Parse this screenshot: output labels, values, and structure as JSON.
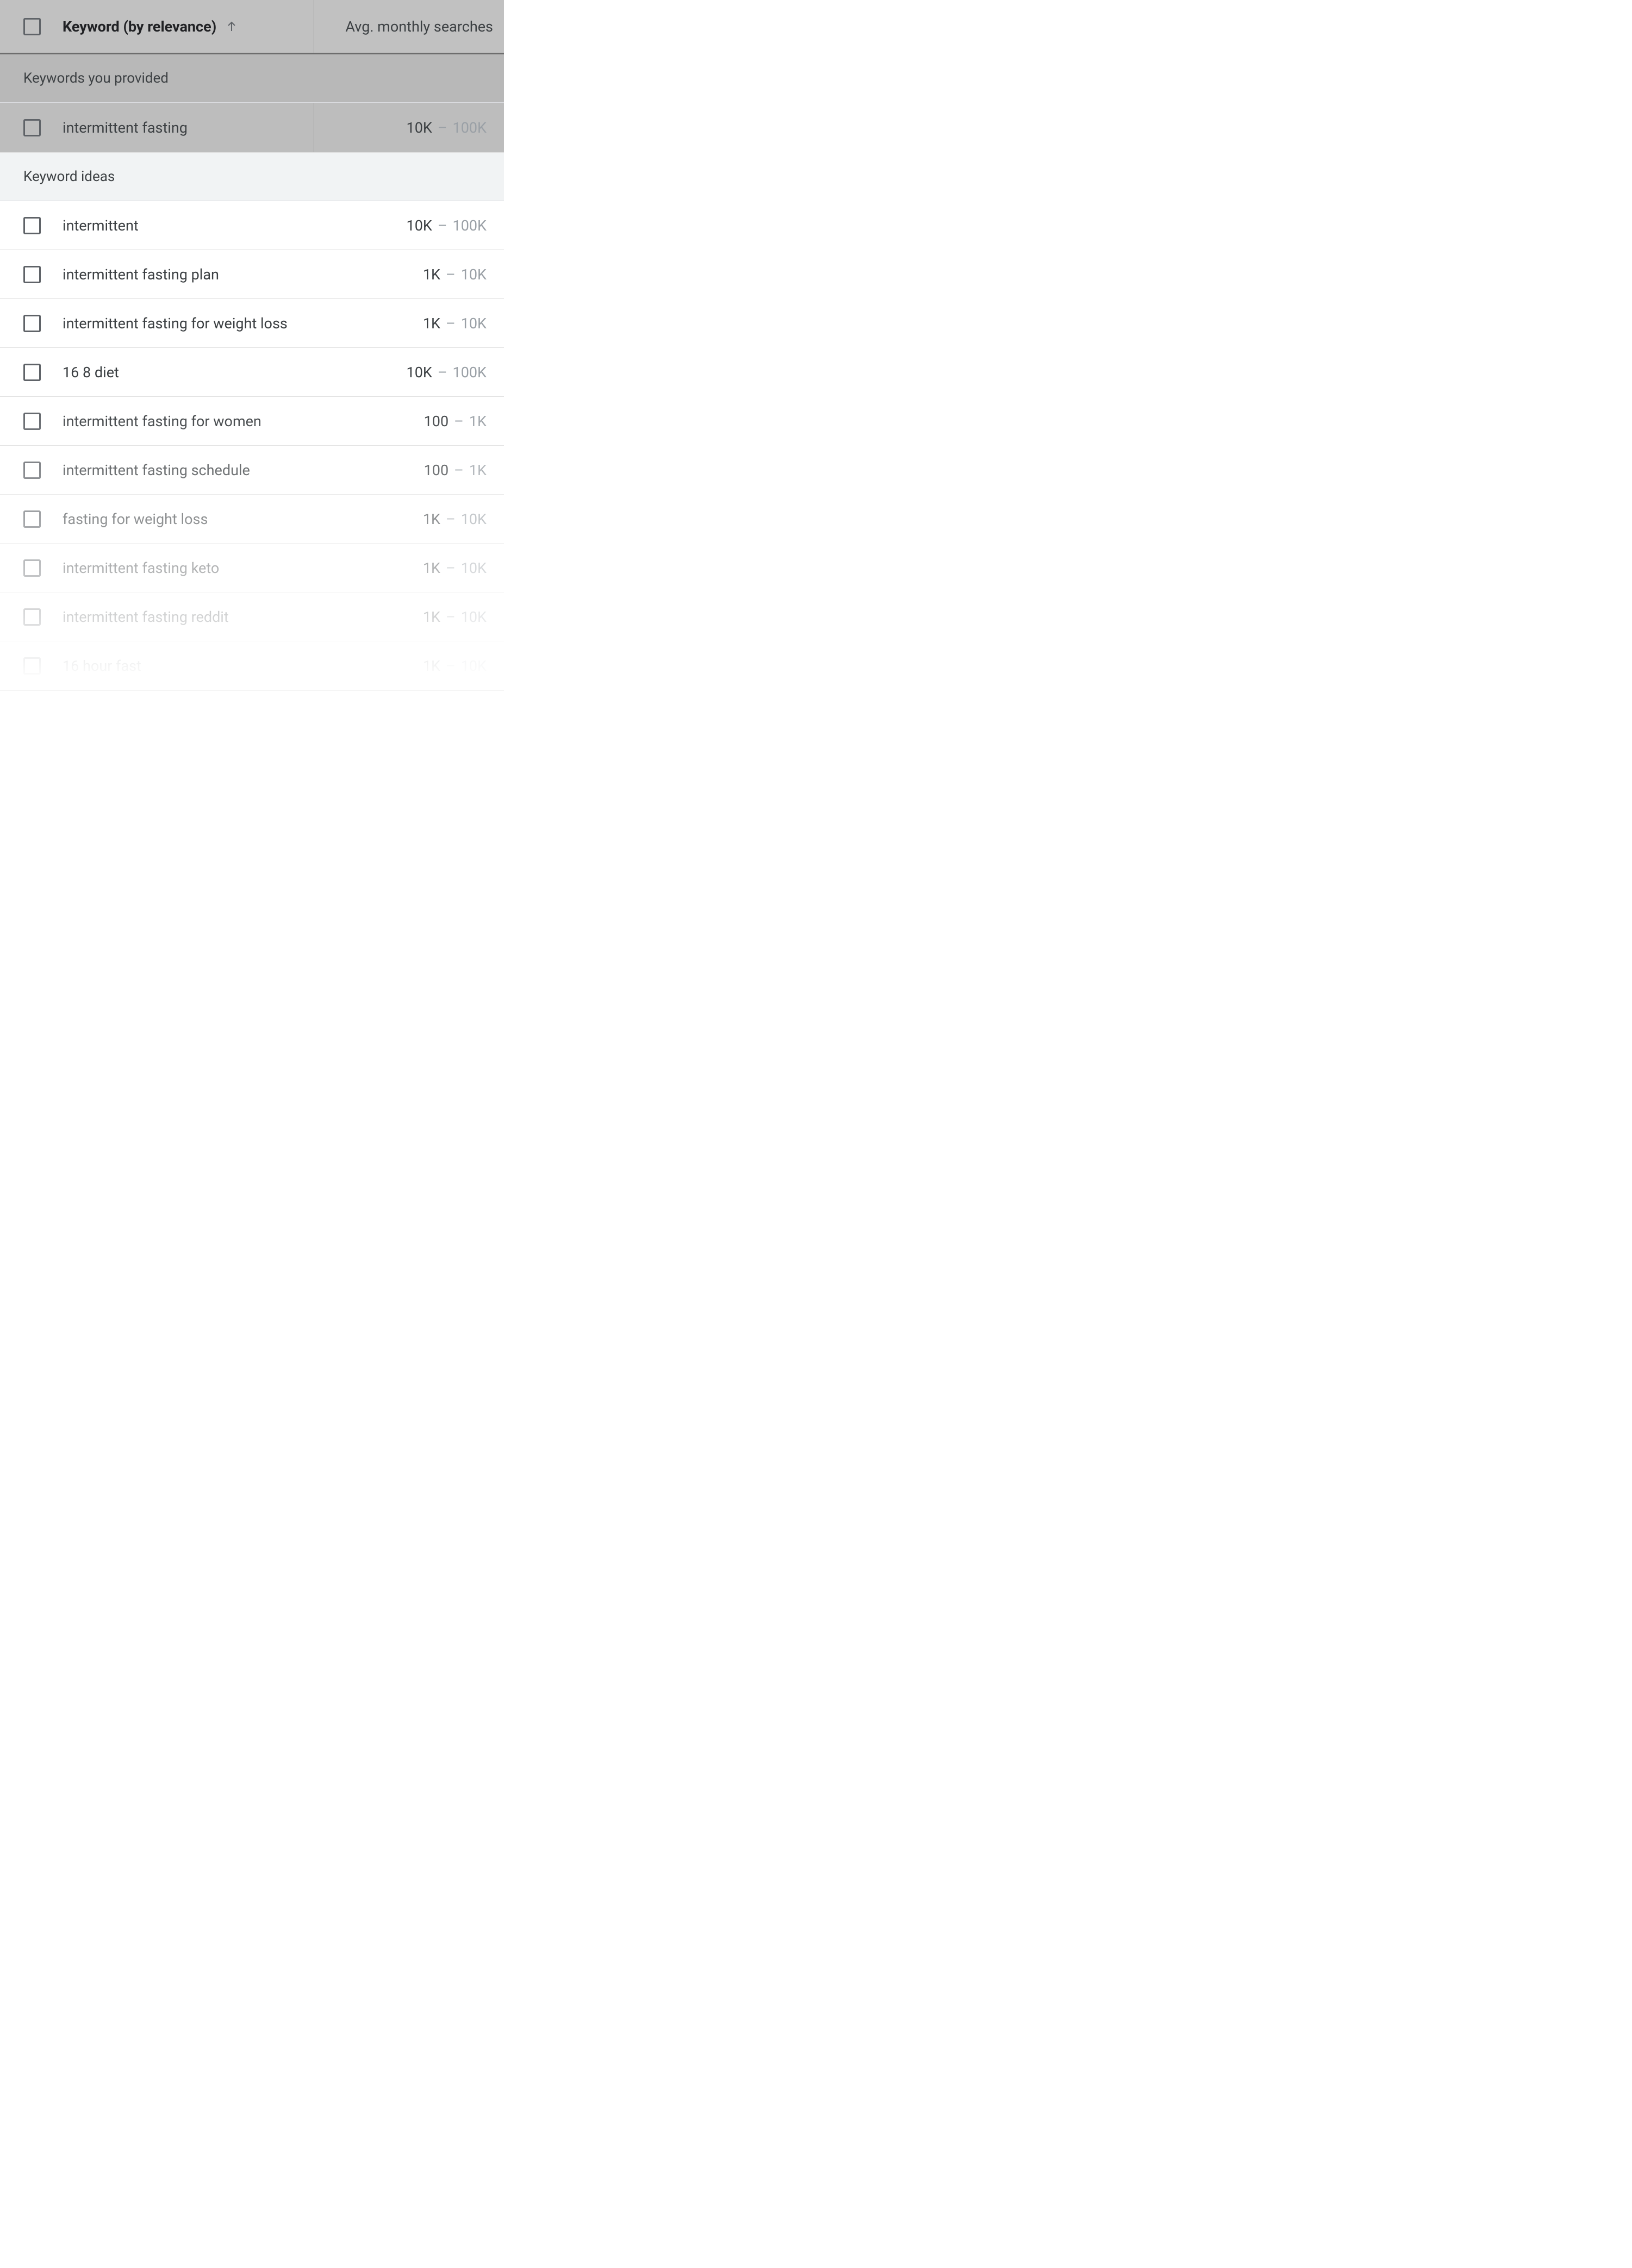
{
  "header": {
    "keyword_column": "Keyword (by relevance)",
    "searches_column": "Avg. monthly searches"
  },
  "sections": {
    "provided_label": "Keywords you provided",
    "ideas_label": "Keyword ideas"
  },
  "provided": [
    {
      "keyword": "intermittent fasting",
      "low": "10K",
      "high": "100K"
    }
  ],
  "ideas": [
    {
      "keyword": "intermittent",
      "low": "10K",
      "high": "100K"
    },
    {
      "keyword": "intermittent fasting plan",
      "low": "1K",
      "high": "10K"
    },
    {
      "keyword": "intermittent fasting for weight loss",
      "low": "1K",
      "high": "10K"
    },
    {
      "keyword": "16 8 diet",
      "low": "10K",
      "high": "100K"
    },
    {
      "keyword": "intermittent fasting for women",
      "low": "100",
      "high": "1K"
    },
    {
      "keyword": "intermittent fasting schedule",
      "low": "100",
      "high": "1K"
    },
    {
      "keyword": "fasting for weight loss",
      "low": "1K",
      "high": "10K"
    },
    {
      "keyword": "intermittent fasting keto",
      "low": "1K",
      "high": "10K"
    },
    {
      "keyword": "intermittent fasting reddit",
      "low": "1K",
      "high": "10K"
    },
    {
      "keyword": "16 hour fast",
      "low": "1K",
      "high": "10K"
    }
  ]
}
